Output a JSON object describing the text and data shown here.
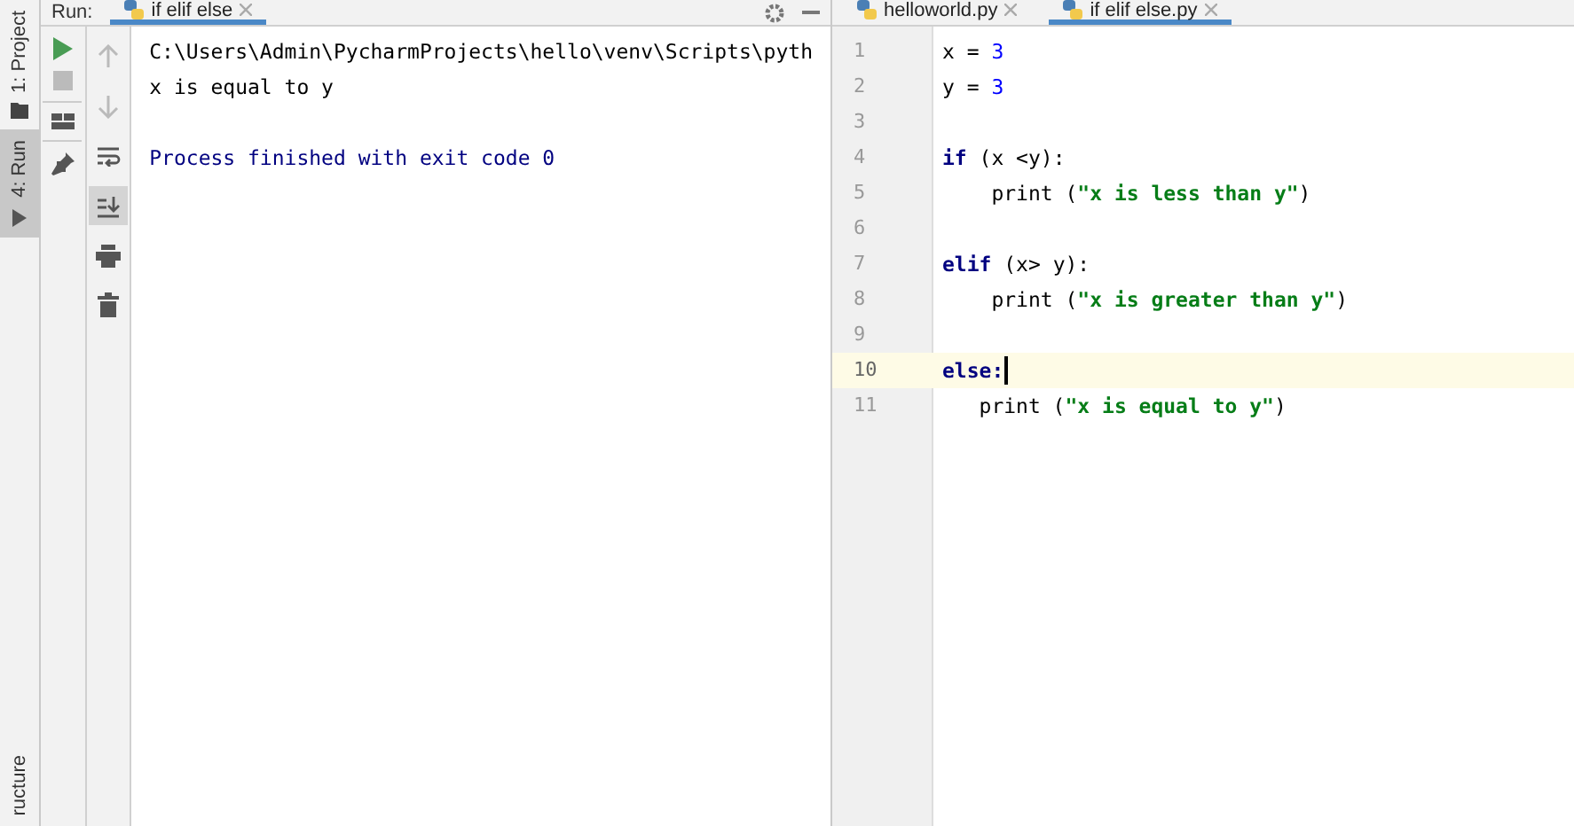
{
  "side_tabs": [
    {
      "label": "1: Project",
      "selected": false
    },
    {
      "label": "4: Run",
      "selected": true
    }
  ],
  "side_bottom_tab": {
    "label": "ructure"
  },
  "run_panel": {
    "label": "Run:",
    "tab": {
      "label": "if elif else"
    },
    "tools": [
      {
        "kind": "up",
        "disabled": true,
        "selected": false
      },
      {
        "kind": "down",
        "disabled": true,
        "selected": false
      },
      {
        "kind": "wrap",
        "disabled": false,
        "selected": false
      },
      {
        "kind": "scroll-end",
        "disabled": false,
        "selected": true
      },
      {
        "kind": "print",
        "disabled": false,
        "selected": false
      },
      {
        "kind": "trash",
        "disabled": false,
        "selected": false
      }
    ],
    "console": [
      {
        "kind": "command",
        "text": "C:\\Users\\Admin\\PycharmProjects\\hello\\venv\\Scripts\\pyth"
      },
      {
        "kind": "output",
        "text": "x is equal to y"
      },
      {
        "kind": "blank"
      },
      {
        "kind": "process",
        "text": "Process finished with exit code 0"
      }
    ]
  },
  "editor": {
    "tabs": [
      {
        "label": "helloworld.py",
        "selected": false
      },
      {
        "label": "if elif else.py",
        "selected": true
      }
    ],
    "lines": [
      {
        "number": "1",
        "current": false,
        "tokens": [
          {
            "kind": "plain",
            "text": "x = "
          },
          {
            "kind": "number",
            "text": "3"
          }
        ]
      },
      {
        "number": "2",
        "current": false,
        "tokens": [
          {
            "kind": "plain",
            "text": "y = "
          },
          {
            "kind": "number",
            "text": "3"
          }
        ]
      },
      {
        "number": "3",
        "current": false
      },
      {
        "number": "4",
        "current": false,
        "tokens": [
          {
            "kind": "keyword",
            "text": "if"
          },
          {
            "kind": "plain",
            "text": " (x <y):"
          }
        ]
      },
      {
        "number": "5",
        "current": false,
        "tokens": [
          {
            "kind": "plain",
            "text": "    print ("
          },
          {
            "kind": "string",
            "text": "\"x is less than y\""
          },
          {
            "kind": "plain",
            "text": ")"
          }
        ]
      },
      {
        "number": "6",
        "current": false
      },
      {
        "number": "7",
        "current": false,
        "tokens": [
          {
            "kind": "keyword",
            "text": "elif"
          },
          {
            "kind": "plain",
            "text": " (x> y):"
          }
        ]
      },
      {
        "number": "8",
        "current": false,
        "tokens": [
          {
            "kind": "plain",
            "text": "    print ("
          },
          {
            "kind": "string",
            "text": "\"x is greater than y\""
          },
          {
            "kind": "plain",
            "text": ")"
          }
        ]
      },
      {
        "number": "9",
        "current": false
      },
      {
        "number": "10",
        "current": true,
        "tokens": [
          {
            "kind": "keyword",
            "text": "else:"
          }
        ]
      },
      {
        "number": "11",
        "current": false,
        "tokens": [
          {
            "kind": "plain",
            "text": "   print ("
          },
          {
            "kind": "string",
            "text": "\"x is equal to y\""
          },
          {
            "kind": "plain",
            "text": ")"
          }
        ]
      }
    ]
  }
}
